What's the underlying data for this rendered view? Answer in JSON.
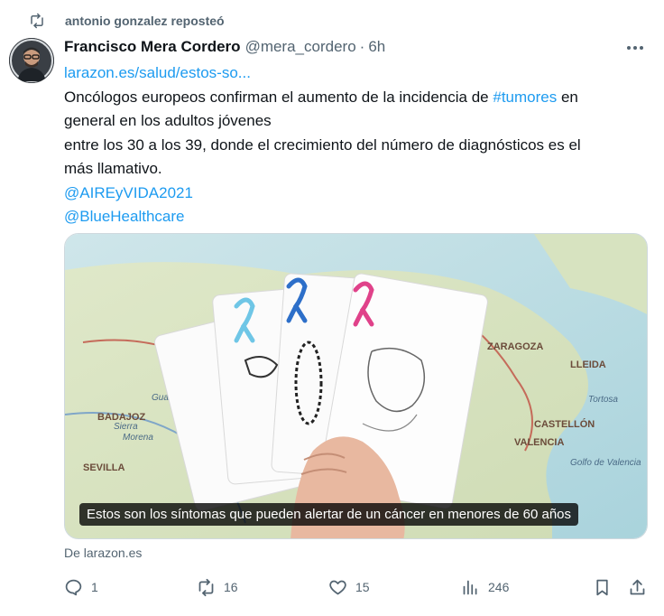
{
  "repost": {
    "icon": "repost-icon",
    "text": "antonio gonzalez reposteó"
  },
  "tweet": {
    "author_name": "Francisco Mera Cordero",
    "author_handle": "@mera_cordero",
    "separator": "·",
    "time": "6h",
    "more_icon": "more-dots-icon",
    "link_url_text": "larazon.es/salud/estos-so...",
    "body_line1_prefix": "Oncólogos europeos confirman el aumento de la incidencia de ",
    "hashtag": "#tumores",
    "body_line1_suffix": " en",
    "body_line2": "general en los adultos jóvenes",
    "body_line3": "entre los 30 a los 39, donde el crecimiento del número de diagnósticos es el",
    "body_line4": "más llamativo.",
    "mention1": "@AIREyVIDA2021",
    "mention2": "@BlueHealthcare"
  },
  "media": {
    "caption": "Estos son los síntomas que pueden alertar de un cáncer en menores de 60 años",
    "map_labels": [
      "ZARAGOZA",
      "LLEIDA",
      "CASTELLÓN",
      "VALENCIA",
      "BADAJOZ",
      "SEVILLA",
      "Golfo de Valencia",
      "Tortosa",
      "Guadiana",
      "Sierra",
      "Morena"
    ],
    "ribbons": [
      "light-blue",
      "blue",
      "pink"
    ]
  },
  "source_text": "De larazon.es",
  "actions": {
    "reply": {
      "icon": "reply-icon",
      "count": "1"
    },
    "repost": {
      "icon": "repost-icon",
      "count": "16"
    },
    "like": {
      "icon": "heart-icon",
      "count": "15"
    },
    "views": {
      "icon": "views-chart-icon",
      "count": "246"
    },
    "bookmark": {
      "icon": "bookmark-icon"
    },
    "share": {
      "icon": "share-icon"
    }
  },
  "colors": {
    "accent": "#1d9bf0",
    "muted": "#536471",
    "text": "#0f1419"
  }
}
